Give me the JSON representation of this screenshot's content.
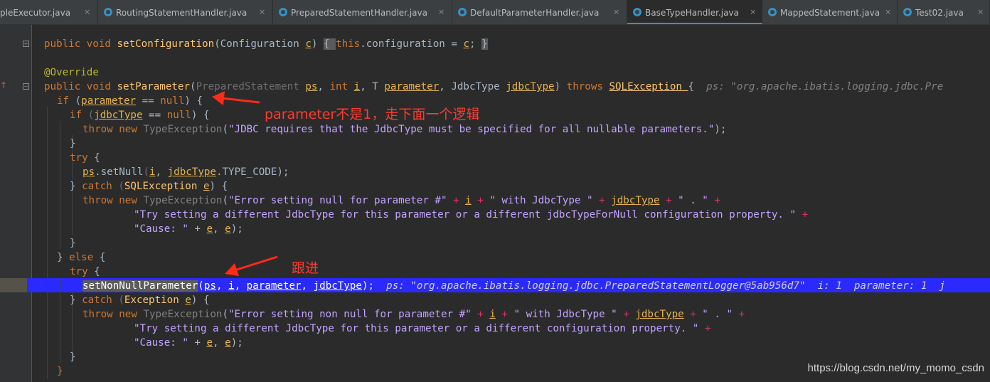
{
  "tabs": [
    {
      "label": "pleExecutor.java",
      "active": false
    },
    {
      "label": "RoutingStatementHandler.java",
      "active": false
    },
    {
      "label": "PreparedStatementHandler.java",
      "active": false
    },
    {
      "label": "DefaultParameterHandler.java",
      "active": false
    },
    {
      "label": "BaseTypeHandler.java",
      "active": true
    },
    {
      "label": "MappedStatement.java",
      "active": false
    },
    {
      "label": "Test02.java",
      "active": false
    }
  ],
  "tab_close_glyph": "×",
  "code": {
    "l01": {
      "t1": "public ",
      "t2": "void ",
      "t3": "setConfiguration",
      "t4": "(Configuration ",
      "t5": "c",
      "t6": ") ",
      "t7": "{ ",
      "t8": "this",
      "t9": ".configuration = ",
      "t10": "c",
      "t11": "; ",
      "t12": "}"
    },
    "l02": {
      "t1": "@Override"
    },
    "l03": {
      "t1": "public ",
      "t2": "void ",
      "t3": "setParameter",
      "t4": "(",
      "t5": "PreparedStatement ",
      "t6": "ps",
      "t7": ", ",
      "t8": "int ",
      "t9": "i",
      "t10": ", T ",
      "t11": "parameter",
      "t12": ", JdbcType ",
      "t13": "jdbcType",
      "t14": ") ",
      "t15": "throws ",
      "t16": "SQLException ",
      "t17": "{  ",
      "t18": "ps: \"org.apache.ibatis.logging.jdbc.Pre"
    },
    "l04": {
      "t1": "if ",
      "t2": "(",
      "t3": "parameter",
      "t4": " == ",
      "t5": "null",
      "t6": ") {"
    },
    "l05": {
      "t1": "if ",
      "t2": "(",
      "t3": "jdbcType",
      "t4": " == ",
      "t5": "null",
      "t6": ") {"
    },
    "l06": {
      "t1": "throw ",
      "t2": "new ",
      "t3": "TypeException",
      "t4": "(",
      "t5": "\"JDBC requires that the JdbcType must be specified for all nullable parameters.\"",
      "t6": ");"
    },
    "l07": {
      "t1": "}"
    },
    "l08": {
      "t1": "try ",
      "t2": "{"
    },
    "l09": {
      "t1": "ps",
      "t2": ".setNull",
      "t3": "(",
      "t4": "i",
      "t5": ", ",
      "t6": "jdbcType",
      "t7": ".TYPE_CODE",
      "t8": ");"
    },
    "l10": {
      "t1": "} ",
      "t2": "catch ",
      "t3": "(",
      "t4": "SQLException ",
      "t5": "e",
      "t6": ") {"
    },
    "l11": {
      "t1": "throw ",
      "t2": "new ",
      "t3": "TypeException",
      "t4": "(",
      "t5": "\"Error setting null for parameter #\"",
      "t6": " + ",
      "t7": "i",
      "t8": " + ",
      "t9": "\" with JdbcType \"",
      "t10": " + ",
      "t11": "jdbcType",
      "t12": " + ",
      "t13": "\" . \"",
      "t14": " +"
    },
    "l12": {
      "t1": "\"Try setting a different JdbcType for this parameter or a different jdbcTypeForNull configuration property. \"",
      "t2": " +"
    },
    "l13": {
      "t1": "\"Cause: \"",
      "t2": " + ",
      "t3": "e",
      "t4": ", ",
      "t5": "e",
      "t6": ");"
    },
    "l14": {
      "t1": "}"
    },
    "l15": {
      "t1": "} ",
      "t2": "else ",
      "t3": "{"
    },
    "l16": {
      "t1": "try ",
      "t2": "{"
    },
    "l17": {
      "t1": "setNonNullParameter",
      "t2": "(",
      "t3": "ps",
      "t4": ", ",
      "t5": "i",
      "t6": ", ",
      "t7": "parameter",
      "t8": ", ",
      "t9": "jdbcType",
      "t10": ");  ",
      "t11": "ps: \"org.apache.ibatis.logging.jdbc.PreparedStatementLogger@5ab956d7\"  i: 1  parameter: 1  j"
    },
    "l18": {
      "t1": "} ",
      "t2": "catch ",
      "t3": "(",
      "t4": "Exception ",
      "t5": "e",
      "t6": ") {"
    },
    "l19": {
      "t1": "throw ",
      "t2": "new ",
      "t3": "TypeException",
      "t4": "(",
      "t5": "\"Error setting non null for parameter #\"",
      "t6": " + ",
      "t7": "i",
      "t8": " + ",
      "t9": "\" with JdbcType \"",
      "t10": " + ",
      "t11": "jdbcType",
      "t12": " + ",
      "t13": "\" . \"",
      "t14": " +"
    },
    "l20": {
      "t1": "\"Try setting a different JdbcType for this parameter or a different configuration property. \"",
      "t2": " +"
    },
    "l21": {
      "t1": "\"Cause: \"",
      "t2": " + ",
      "t3": "e",
      "t4": ", ",
      "t5": "e",
      "t6": ");"
    },
    "l22": {
      "t1": "}"
    },
    "l23": {
      "t1": "}"
    }
  },
  "annotations": {
    "note1": "parameter不是1，走下面一个逻辑",
    "note2": "跟进"
  },
  "watermark": "https://blog.csdn.net/my_momo_csdn",
  "colors": {
    "keyword": "#cc7832",
    "string": "#6a8759",
    "method": "#ffc66d",
    "annotation_text": "#ff3b30",
    "execution_line": "#2a2aff"
  },
  "icons": {
    "tab_file_icon": "java-class-icon",
    "fold_marker": "fold-marker-icon",
    "override_marker": "override-gutter-icon",
    "arrow": "red-arrow-icon"
  }
}
